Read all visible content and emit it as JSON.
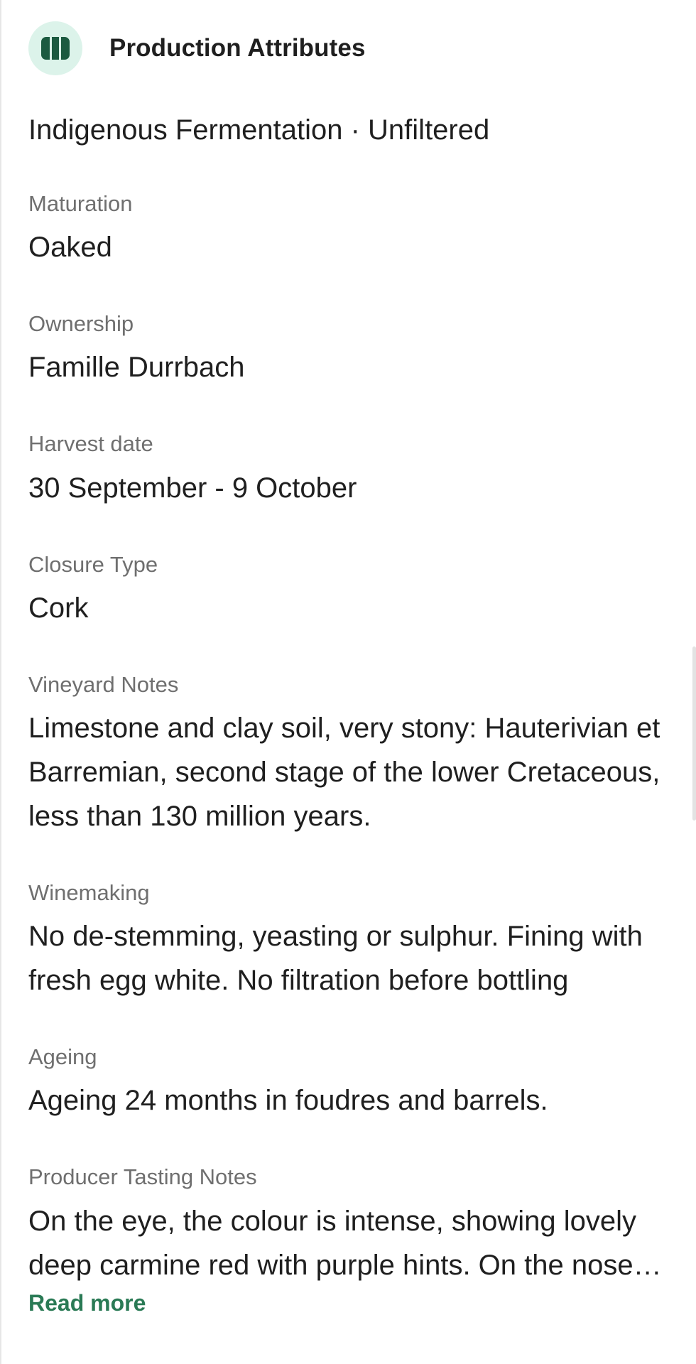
{
  "header": {
    "title": "Production Attributes",
    "icon": "vineyard-rows-icon",
    "icon_bg": "#dcf3ea",
    "icon_fg": "#1b5a40"
  },
  "summary": "Indigenous Fermentation · Unfiltered",
  "attributes": [
    {
      "label": "Maturation",
      "value": "Oaked"
    },
    {
      "label": "Ownership",
      "value": "Famille Durrbach"
    },
    {
      "label": "Harvest date",
      "value": "30 September - 9 October"
    },
    {
      "label": "Closure Type",
      "value": "Cork"
    },
    {
      "label": "Vineyard Notes",
      "value": "Limestone and clay soil, very stony: Hauterivian et Barremian, second stage of the lower Cretaceous, less than 130 million years."
    },
    {
      "label": "Winemaking",
      "value": "No de-stemming, yeasting or sulphur. Fining with fresh egg white. No filtration before bottling"
    },
    {
      "label": "Ageing",
      "value": "Ageing 24 months in foudres and barrels."
    },
    {
      "label": "Producer Tasting Notes",
      "value": "On the eye, the colour is intense, showing lovely deep carmine red with purple hints. On the nose…"
    }
  ],
  "read_more_label": "Read more",
  "colors": {
    "accent": "#2a7a55",
    "label": "#6f6f6f",
    "text": "#1f1f1f"
  }
}
